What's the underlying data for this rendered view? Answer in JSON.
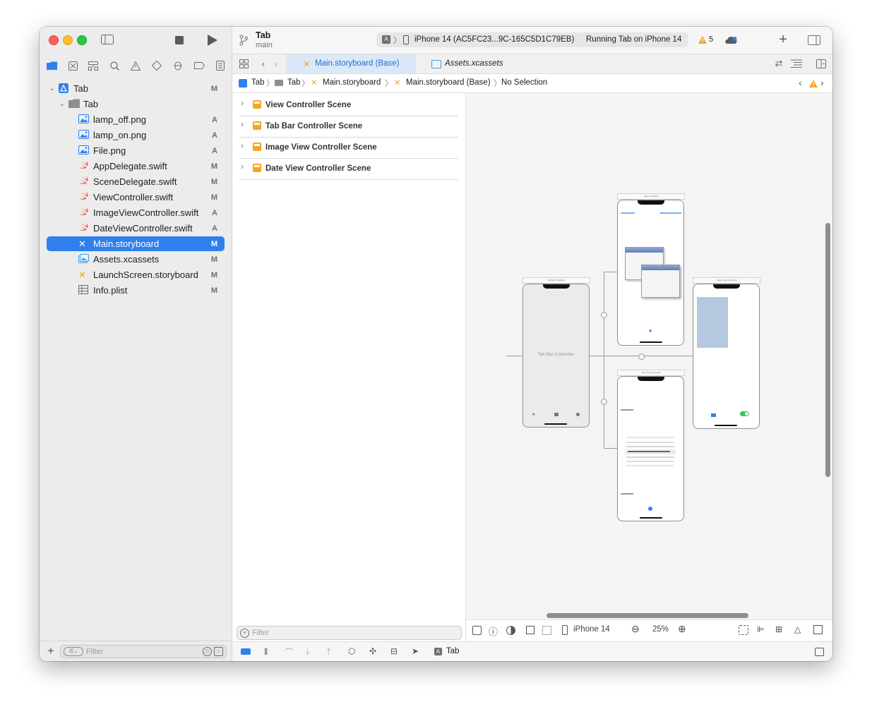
{
  "sidebar": {
    "root": {
      "label": "Tab",
      "status": "M"
    },
    "group": {
      "label": "Tab"
    },
    "files": [
      {
        "label": "lamp_off.png",
        "status": "A",
        "kind": "image"
      },
      {
        "label": "lamp_on.png",
        "status": "A",
        "kind": "image"
      },
      {
        "label": "File.png",
        "status": "A",
        "kind": "image"
      },
      {
        "label": "AppDelegate.swift",
        "status": "M",
        "kind": "swift"
      },
      {
        "label": "SceneDelegate.swift",
        "status": "M",
        "kind": "swift"
      },
      {
        "label": "ViewController.swift",
        "status": "M",
        "kind": "swift"
      },
      {
        "label": "ImageViewController.swift",
        "status": "A",
        "kind": "swift"
      },
      {
        "label": "DateViewController.swift",
        "status": "A",
        "kind": "swift"
      },
      {
        "label": "Main.storyboard",
        "status": "M",
        "kind": "storyboard",
        "selected": true
      },
      {
        "label": "Assets.xcassets",
        "status": "M",
        "kind": "assets"
      },
      {
        "label": "LaunchScreen.storyboard",
        "status": "M",
        "kind": "storyboard"
      },
      {
        "label": "Info.plist",
        "status": "M",
        "kind": "plist"
      }
    ],
    "filter_placeholder": "Filter"
  },
  "toolbar": {
    "project": "Tab",
    "branch": "main",
    "device": "iPhone 14 (AC5FC23...9C-165C5D1C79EB)",
    "status": "Running Tab on iPhone 14",
    "warnings": "5"
  },
  "tabs": [
    {
      "label": "Main.storyboard (Base)",
      "active": true
    },
    {
      "label": "Assets.xcassets",
      "active": false
    }
  ],
  "jumpbar": [
    "Tab",
    "Tab",
    "Main.storyboard",
    "Main.storyboard (Base)",
    "No Selection"
  ],
  "outline": {
    "scenes": [
      "View Controller Scene",
      "Tab Bar Controller Scene",
      "Image View Controller Scene",
      "Date View Controller Scene"
    ],
    "filter_placeholder": "Filter"
  },
  "canvas": {
    "tab_bar_controller": "Tab Bar Controller",
    "device": "iPhone 14",
    "zoom": "25%"
  },
  "debugbar": {
    "target": "Tab"
  },
  "colors": {
    "accent": "#2f80ed",
    "warning": "#f5a623",
    "swift": "#f05138"
  }
}
